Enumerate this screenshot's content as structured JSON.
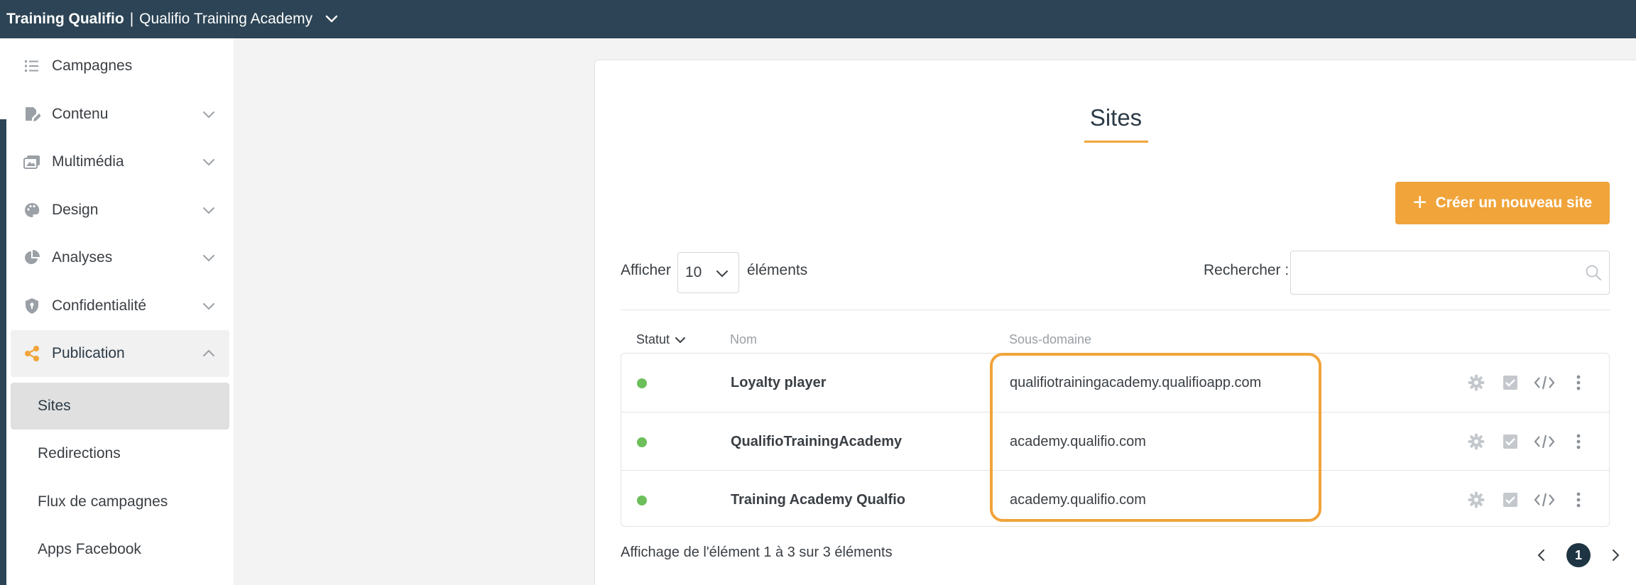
{
  "topbar": {
    "org_name": "Training Qualifio",
    "separator": "|",
    "account_name": "Qualifio Training Academy",
    "chevron_icon": "chevron-down-icon"
  },
  "sidebar": {
    "items": [
      {
        "label": "Campagnes",
        "icon": "list-icon",
        "expandable": false
      },
      {
        "label": "Contenu",
        "icon": "edit-content-icon",
        "expandable": true
      },
      {
        "label": "Multimédia",
        "icon": "images-icon",
        "expandable": true
      },
      {
        "label": "Design",
        "icon": "palette-icon",
        "expandable": true
      },
      {
        "label": "Analyses",
        "icon": "pie-chart-icon",
        "expandable": true
      },
      {
        "label": "Confidentialité",
        "icon": "shield-icon",
        "expandable": true
      },
      {
        "label": "Publication",
        "icon": "share-icon",
        "expandable": true,
        "expanded": true
      }
    ],
    "sub_items": [
      {
        "label": "Sites",
        "selected": true
      },
      {
        "label": "Redirections",
        "selected": false
      },
      {
        "label": "Flux de campagnes",
        "selected": false
      },
      {
        "label": "Apps Facebook",
        "selected": false
      }
    ]
  },
  "main": {
    "title": "Sites",
    "create_button": "Créer un nouveau site",
    "show_label": "Afficher",
    "page_size": "10",
    "elements_label": "éléments",
    "search_label": "Rechercher :",
    "search_value": "",
    "columns": {
      "status": "Statut",
      "name": "Nom",
      "subdomain": "Sous-domaine"
    },
    "rows": [
      {
        "status": "active",
        "name": "Loyalty player",
        "subdomain": "qualifiotrainingacademy.qualifioapp.com"
      },
      {
        "status": "active",
        "name": "QualifioTrainingAcademy",
        "subdomain": "academy.qualifio.com"
      },
      {
        "status": "active",
        "name": "Training Academy Qualfio",
        "subdomain": "academy.qualifio.com"
      }
    ],
    "info": "Affichage de l'élément 1 à 3 sur 3 éléments",
    "current_page": "1"
  },
  "colors": {
    "topbar": "#2c4455",
    "accent": "#f0a43a",
    "status_active": "#6cbf5a",
    "pager_active": "#1e3442"
  }
}
